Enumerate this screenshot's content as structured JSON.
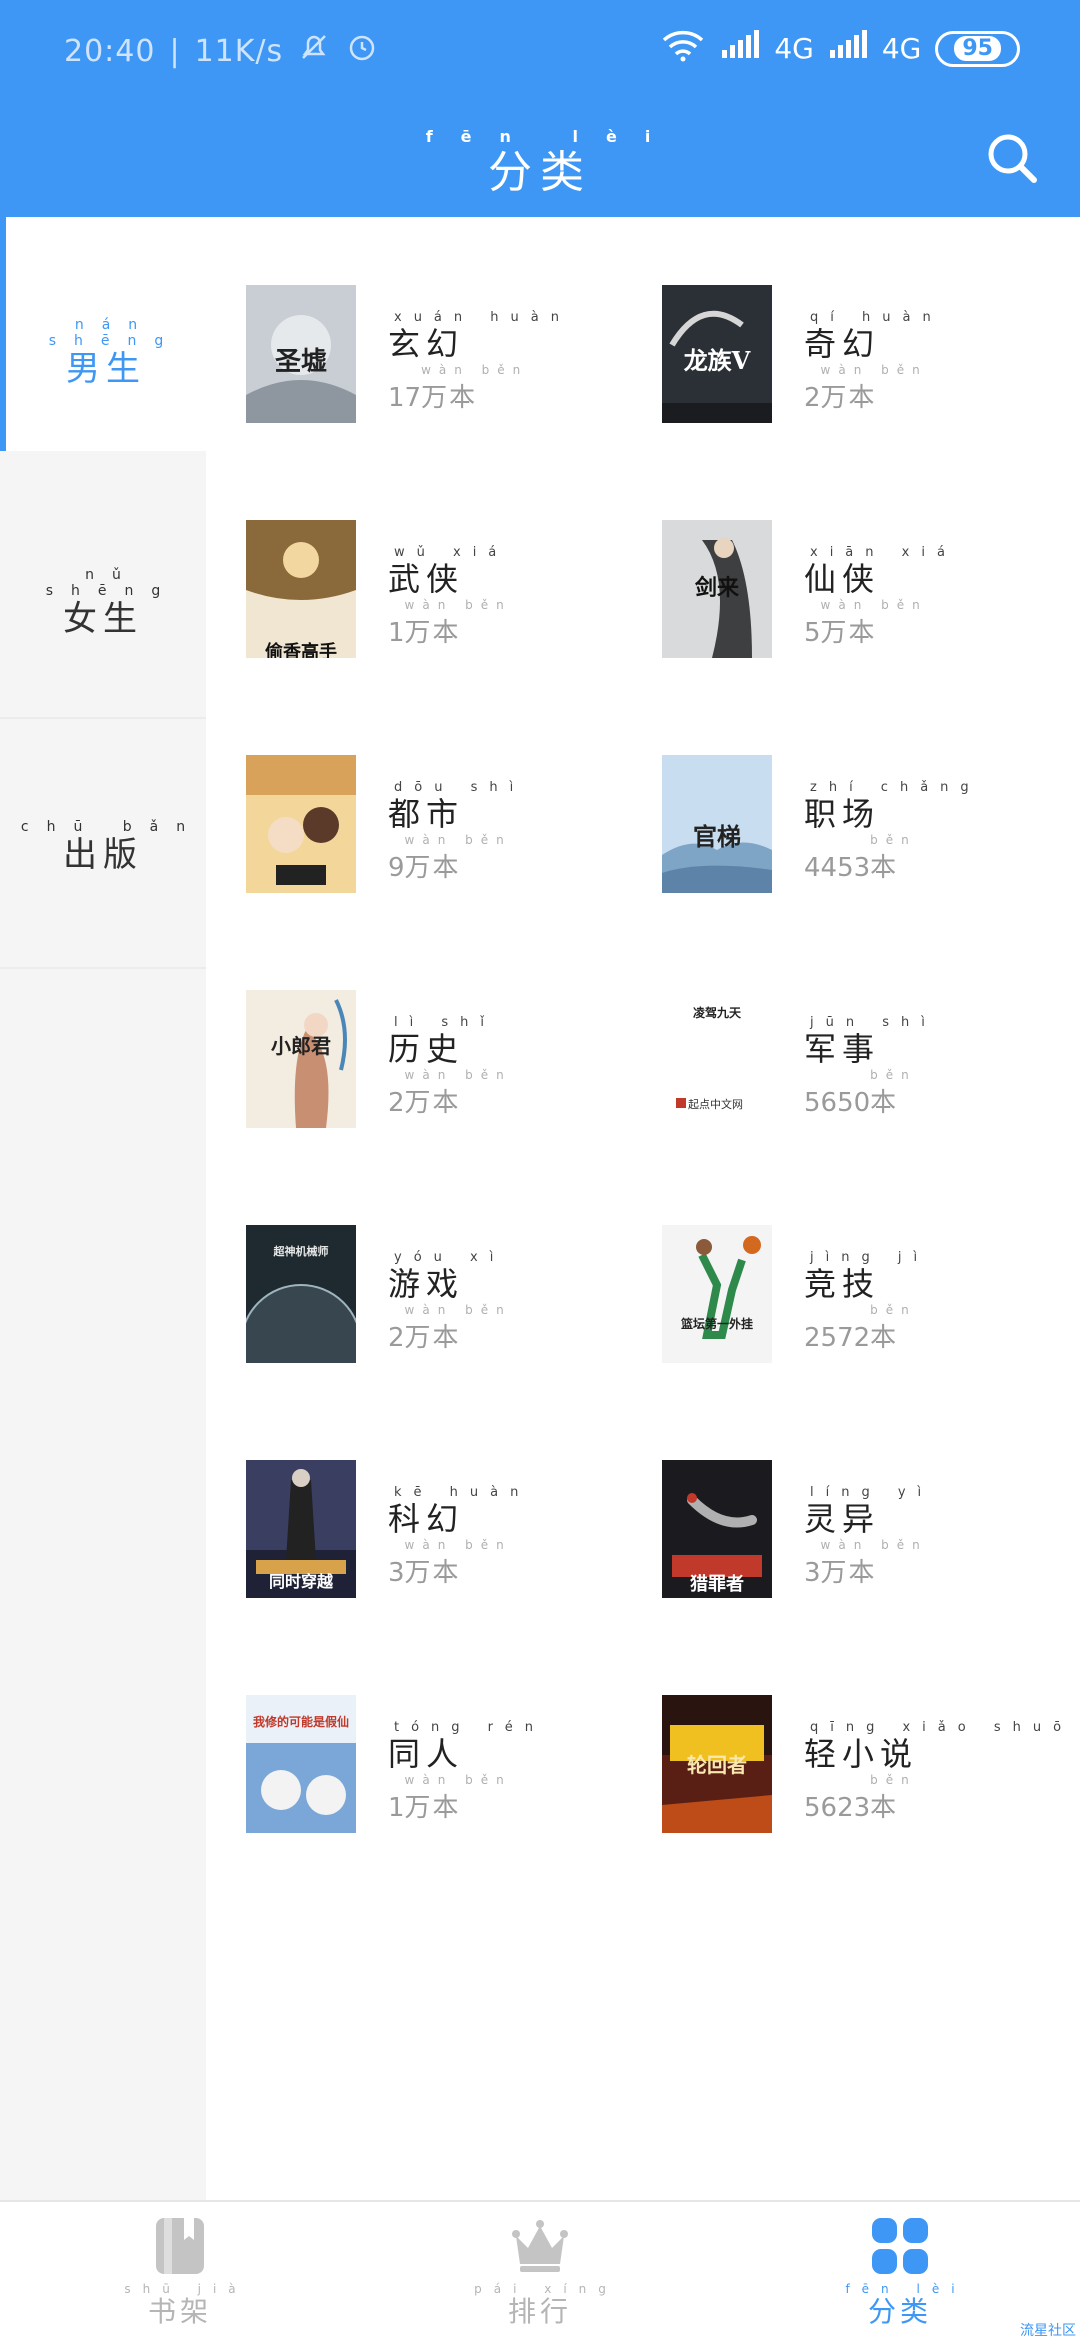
{
  "status_bar": {
    "time": "20:40",
    "speed": "11K/s",
    "network1": "4G",
    "network2": "4G",
    "battery": "95"
  },
  "header": {
    "title": "分类",
    "title_pinyin": "fēn lèi"
  },
  "sidebar": {
    "items": [
      {
        "label": "男生",
        "pinyin": "nán shēng",
        "active": true
      },
      {
        "label": "女生",
        "pinyin": "nǔ shēng",
        "active": false
      },
      {
        "label": "出版",
        "pinyin": "chū bǎn",
        "active": false
      }
    ]
  },
  "categories": [
    {
      "name": "玄幻",
      "pinyin": "xuán huàn",
      "count": "17",
      "unit": "万本",
      "unit_pinyin": "wàn běn",
      "cover_color": "#c9ced4"
    },
    {
      "name": "奇幻",
      "pinyin": "qí huàn",
      "count": "2",
      "unit": "万本",
      "unit_pinyin": "wàn běn",
      "cover_color": "#2b2f36"
    },
    {
      "name": "武侠",
      "pinyin": "wǔ xiá",
      "count": "1",
      "unit": "万本",
      "unit_pinyin": "wàn běn",
      "cover_color": "#8a6a3a"
    },
    {
      "name": "仙侠",
      "pinyin": "xiān xiá",
      "count": "5",
      "unit": "万本",
      "unit_pinyin": "wàn běn",
      "cover_color": "#6b6e70"
    },
    {
      "name": "都市",
      "pinyin": "dōu shì",
      "count": "9",
      "unit": "万本",
      "unit_pinyin": "wàn běn",
      "cover_color": "#d8a25b"
    },
    {
      "name": "职场",
      "pinyin": "zhí chǎng",
      "count": "4453",
      "unit": "本",
      "unit_pinyin": "běn",
      "cover_color": "#9dc3e4"
    },
    {
      "name": "历史",
      "pinyin": "lì shǐ",
      "count": "2",
      "unit": "万本",
      "unit_pinyin": "wàn běn",
      "cover_color": "#efe6d8"
    },
    {
      "name": "军事",
      "pinyin": "jūn shì",
      "count": "5650",
      "unit": "本",
      "unit_pinyin": "běn",
      "cover_color": "#ffffff"
    },
    {
      "name": "游戏",
      "pinyin": "yóu xì",
      "count": "2",
      "unit": "万本",
      "unit_pinyin": "wàn běn",
      "cover_color": "#1f2a30"
    },
    {
      "name": "竞技",
      "pinyin": "jìng jì",
      "count": "2572",
      "unit": "本",
      "unit_pinyin": "běn",
      "cover_color": "#f4f4f4"
    },
    {
      "name": "科幻",
      "pinyin": "kē huàn",
      "count": "3",
      "unit": "万本",
      "unit_pinyin": "wàn běn",
      "cover_color": "#3a3f62"
    },
    {
      "name": "灵异",
      "pinyin": "líng yì",
      "count": "3",
      "unit": "万本",
      "unit_pinyin": "wàn běn",
      "cover_color": "#1b1b1f"
    },
    {
      "name": "同人",
      "pinyin": "tóng rén",
      "count": "1",
      "unit": "万本",
      "unit_pinyin": "wàn běn",
      "cover_color": "#7ba7d8"
    },
    {
      "name": "轻小说",
      "pinyin": "qīng xiǎo shuō",
      "count": "5623",
      "unit": "本",
      "unit_pinyin": "běn",
      "cover_color": "#5a1f14"
    }
  ],
  "cover_texts": {
    "c0": "圣墟",
    "c1": "龙族V",
    "c2": "偷香高手",
    "c3": "剑来",
    "c4": "",
    "c5": "官梯",
    "c6": "小郎君",
    "c7": "凌驾九天",
    "c7b": "起点中文网",
    "c8": "超神机械师",
    "c9": "篮坛第一外挂",
    "c10": "同时穿越",
    "c11": "猎罪者",
    "c12": "我修的可能是假仙",
    "c13": "轮回者"
  },
  "bottom_nav": [
    {
      "label": "书架",
      "pinyin": "shū jià",
      "icon": "bookshelf-icon",
      "active": false
    },
    {
      "label": "排行",
      "pinyin": "pái xíng",
      "icon": "crown-icon",
      "active": false
    },
    {
      "label": "分类",
      "pinyin": "fēn lèi",
      "icon": "grid-icon",
      "active": true
    }
  ],
  "watermark": "流星社区",
  "colors": {
    "accent": "#3e97f4",
    "sidebar_bg": "#f5f5f5",
    "muted": "#9a9a9a"
  }
}
